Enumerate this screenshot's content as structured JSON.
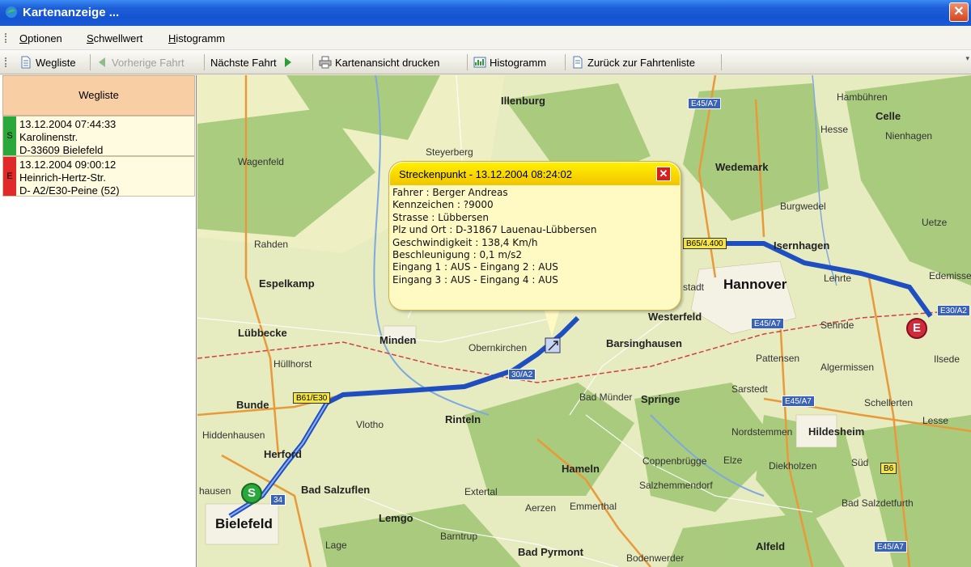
{
  "window": {
    "title": "Kartenanzeige ...",
    "close_glyph": "✕"
  },
  "menu": [
    "Optionen",
    "Schwellwert",
    "Histogramm"
  ],
  "toolbar": {
    "wegliste": "Wegliste",
    "prev": "Vorherige Fahrt",
    "next": "Nächste Fahrt",
    "print": "Kartenansicht drucken",
    "histogram": "Histogramm",
    "back": "Zurück zur Fahrtenliste"
  },
  "sidebar": {
    "header": "Wegliste",
    "rows": [
      {
        "marker": "S",
        "color": "#2aa83c",
        "lines": [
          "13.12.2004 07:44:33",
          "Karolinenstr.",
          "D-33609 Bielefeld"
        ]
      },
      {
        "marker": "E",
        "color": "#e02a2a",
        "lines": [
          "13.12.2004 09:00:12",
          "Heinrich-Hertz-Str.",
          "D- A2/E30-Peine (52)"
        ]
      }
    ]
  },
  "popup": {
    "title": "Streckenpunkt - 13.12.2004 08:24:02",
    "lines": [
      "Fahrer : Berger Andreas",
      "Kennzeichen : ?9000",
      "Strasse : Lübbersen",
      "Plz und Ort : D-31867 Lauenau-Lübbersen",
      "Geschwindigkeit : 138,4 Km/h",
      "Beschleunigung : 0,1 m/s2",
      "Eingang 1 : AUS - Eingang 2 : AUS",
      "Eingang 3 : AUS - Eingang 4 : AUS"
    ]
  },
  "map": {
    "places": {
      "hannover": "Hannover",
      "bielefeld": "Bielefeld",
      "hildesheim": "Hildesheim",
      "celle": "Celle",
      "wedemark": "Wedemark",
      "isernhagen": "Isernhagen",
      "minden": "Minden",
      "espelkamp": "Espelkamp",
      "luebbecke": "Lübbecke",
      "bunde": "Bunde",
      "herford": "Herford",
      "bad_salzuflen": "Bad Salzuflen",
      "lemgo": "Lemgo",
      "rinteln": "Rinteln",
      "hameln": "Hameln",
      "springe": "Springe",
      "barsinghausen": "Barsinghausen",
      "westerfeld": "Westerfeld",
      "bad_pyrmont": "Bad Pyrmont",
      "alfeld": "Alfeld",
      "lage": "Lage",
      "rahden": "Rahden",
      "wagenfeld": "Wagenfeld",
      "illenburg": "Illenburg",
      "steyerberg": "Steyerberg",
      "hullhorst": "Hüllhorst",
      "lehrte": "Lehrte",
      "sehnde": "Sehnde",
      "ilsede": "Ilsede",
      "lesse": "Lesse",
      "algermissen": "Algermissen",
      "pattensen": "Pattensen",
      "sarstedt": "Sarstedt",
      "bad_munder": "Bad Münder",
      "coppenbrugge": "Coppenbrügge",
      "vlotho": "Vlotho",
      "extertal": "Extertal",
      "aerzen": "Aerzen",
      "emmerthal": "Emmerthal",
      "nordstemmen": "Nordstemmen",
      "diekholzen": "Diekholzen",
      "bad_salzdetfurth": "Bad Salzdetfurth",
      "elze": "Elze",
      "schellerten": "Schellerten",
      "burgwedel": "Burgwedel",
      "hambuhren": "Hambühren",
      "hesse": "Hesse",
      "uetze": "Uetze",
      "edemissen": "Edemissen",
      "obernkirchen": "Obernkirchen",
      "lubbecke2": "Lübbecke",
      "hiddenhausen": "Hiddenhausen",
      "stadt": "stadt",
      "bodenwerder": "Bodenwerder",
      "sud": "Süd",
      "hausen": "hausen",
      "barntrup": "Barntrup",
      "niemhagen": "Nienhagen",
      "salzhemmendorf": "Salzhemmendorf"
    },
    "shields": [
      {
        "label": "E45/A7",
        "kind": "blue"
      },
      {
        "label": "B61/E30",
        "kind": "yellow"
      },
      {
        "label": "E30/A2",
        "kind": "blue"
      },
      {
        "label": "E45/A7",
        "kind": "blue"
      },
      {
        "label": "E45/A7",
        "kind": "blue"
      },
      {
        "label": "B6",
        "kind": "yellow"
      },
      {
        "label": "E45/A7",
        "kind": "blue"
      },
      {
        "label": "34",
        "kind": "blue"
      },
      {
        "label": "30/A2",
        "kind": "blue"
      },
      {
        "label": "B65/4.400",
        "kind": "yellow"
      }
    ],
    "start_marker": "S",
    "end_marker": "E",
    "colors": {
      "route": "#1f4ec0",
      "start": "#2aa83c",
      "end": "#d12a3a",
      "forest": "#9fc672",
      "land": "#e6ebc0"
    }
  }
}
